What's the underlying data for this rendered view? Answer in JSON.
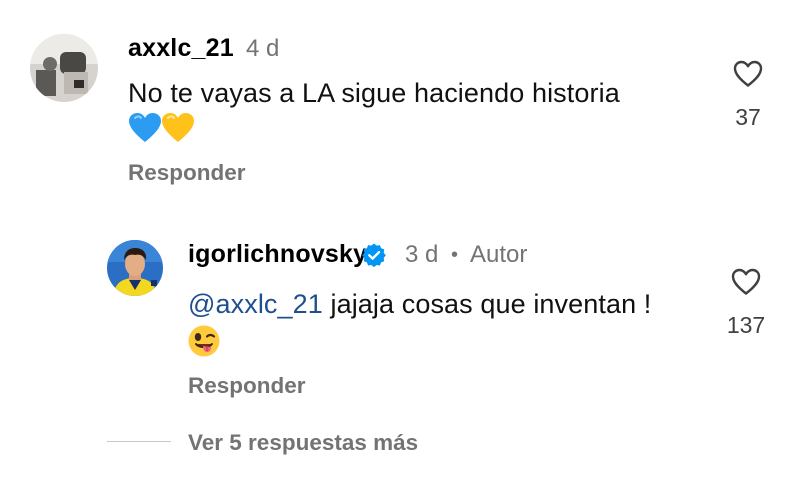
{
  "comments": [
    {
      "username": "axxlc_21",
      "time": "4 d",
      "text": "No te vayas a LA sigue haciendo historia",
      "emoji": [
        "blue-heart",
        "yellow-heart"
      ],
      "likes": "37",
      "reply_label": "Responder"
    },
    {
      "username": "igorlichnovsky",
      "verified": true,
      "time": "3 d",
      "separator": "•",
      "author_badge": "Autor",
      "mention": "@axxlc_21",
      "text": "jajaja cosas que inventan !",
      "emoji": [
        "winking-face-with-tongue"
      ],
      "likes": "137",
      "reply_label": "Responder"
    }
  ],
  "view_replies_label": "Ver 5 respuestas más",
  "colors": {
    "secondary_text": "#737373",
    "mention": "#1f4f8f",
    "verified_badge": "#0095f6",
    "blue_heart": "#2c9cf2",
    "yellow_heart": "#ffc21a",
    "emoji_face": "#ffcb3d"
  }
}
